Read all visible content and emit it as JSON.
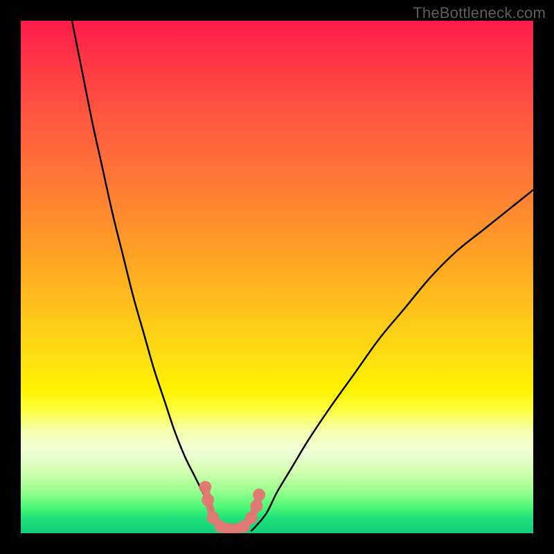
{
  "watermark": "TheBottleneck.com",
  "chart_data": {
    "type": "line",
    "title": "",
    "xlabel": "",
    "ylabel": "",
    "ylim": [
      0,
      100
    ],
    "series": [
      {
        "name": "left-curve",
        "x": [
          10,
          12,
          14,
          16,
          18,
          20,
          22,
          24,
          26,
          28,
          30,
          32,
          34,
          36,
          37,
          38,
          39,
          40
        ],
        "values": [
          100,
          90,
          80,
          71,
          62,
          54,
          46,
          39,
          32,
          26,
          20,
          15,
          11,
          7,
          5,
          3,
          1.5,
          0.5
        ]
      },
      {
        "name": "right-curve",
        "x": [
          45,
          46,
          48,
          50,
          53,
          56,
          60,
          65,
          70,
          75,
          80,
          85,
          90,
          95,
          100
        ],
        "values": [
          0.5,
          1.5,
          4,
          8,
          13,
          18,
          24,
          31,
          38,
          44,
          50,
          55,
          59,
          63,
          67
        ]
      },
      {
        "name": "valley-markers",
        "x": [
          36,
          36.5,
          37.5,
          39,
          40.5,
          42,
          43.5,
          45,
          46,
          46.5
        ],
        "values": [
          9,
          6.5,
          3,
          1.3,
          0.8,
          0.8,
          1.3,
          3,
          5.3,
          7.5
        ]
      }
    ],
    "marker_color": "#e07873",
    "curve_color": "#000000"
  }
}
